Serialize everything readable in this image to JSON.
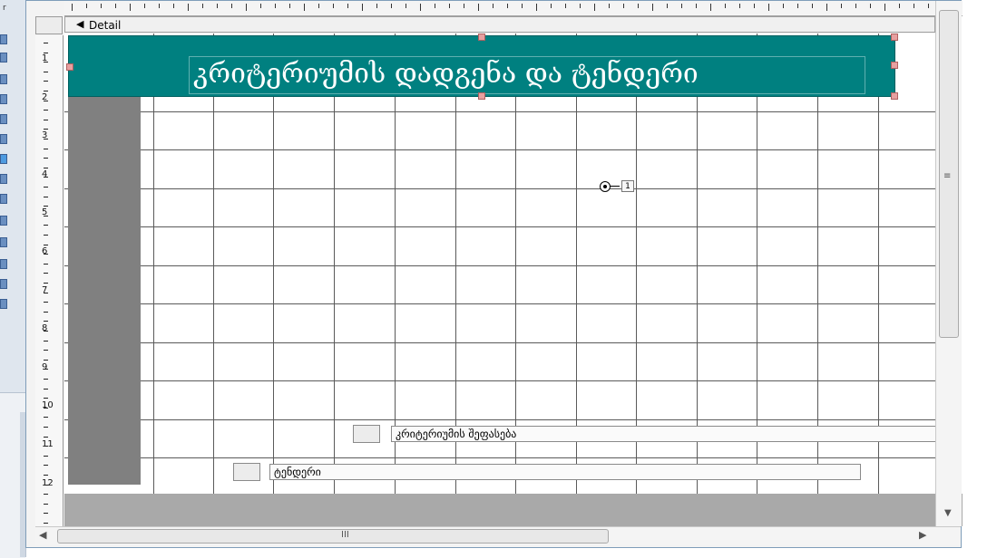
{
  "section": {
    "label": "Detail",
    "arrow_icon": "section-collapse-icon"
  },
  "ruler": {
    "numbers": [
      "1",
      "2",
      "3",
      "4",
      "5",
      "6",
      "7",
      "8",
      "9",
      "10",
      "11",
      "12"
    ]
  },
  "form": {
    "title_text": "კრიტერიუმის დადგენა და ტენდერი",
    "title_bg": "#008080",
    "option_value": "1",
    "controls": [
      {
        "name": "კრიტერიუმის შეფასება"
      },
      {
        "name": "ტენდერი"
      }
    ]
  },
  "scroll": {
    "grip": "≡",
    "hgrip": "III"
  },
  "sidebar": {
    "letter": "r"
  }
}
